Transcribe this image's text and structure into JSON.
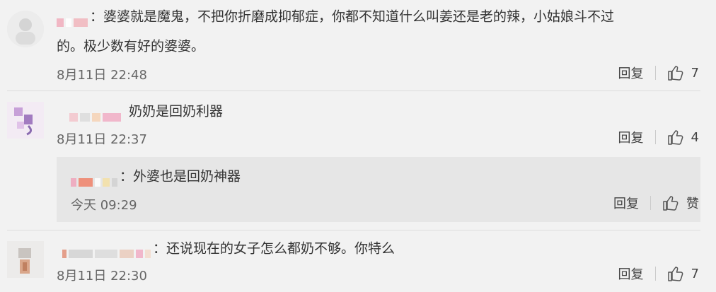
{
  "comments": [
    {
      "text_line1": "：婆婆就是魔鬼，不把你折磨成抑郁症，你都不知道什么叫姜还是老的辣，小姑娘斗不过",
      "text_line2": "的。极少数有好的婆婆。",
      "time": "8月11日 22:48",
      "reply_label": "回复",
      "likes": "7"
    },
    {
      "text_line1": "奶奶是回奶利器",
      "time": "8月11日 22:37",
      "reply_label": "回复",
      "likes": "4",
      "sub_reply": {
        "text": "：外婆也是回奶神器",
        "time": "今天 09:29",
        "reply_label": "回复",
        "like_label": "赞"
      }
    },
    {
      "text_line1": "：还说现在的女子怎么都奶不够。你特么",
      "time": "8月11日 22:30",
      "reply_label": "回复",
      "likes": "7"
    }
  ],
  "icons": {
    "thumb": "thumbs-up-icon"
  },
  "colors": {
    "background": "#f2f2f2",
    "reply_box": "#e6e6e6",
    "text": "#333333",
    "meta": "#666666"
  }
}
